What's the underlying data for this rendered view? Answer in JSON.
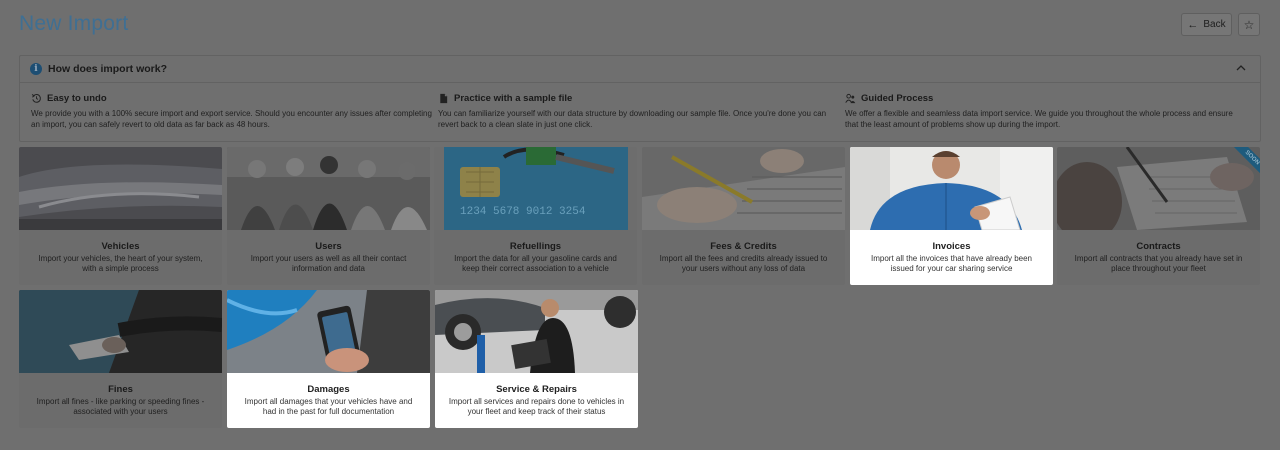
{
  "page": {
    "title": "New Import"
  },
  "header": {
    "back_label": "Back",
    "star_icon": "☆"
  },
  "info": {
    "title": "How does import work?",
    "columns": [
      {
        "icon": "undo-icon",
        "title": "Easy to undo",
        "text": "We provide you with a 100% secure import and export service. Should you encounter any issues after completing an import, you can safely revert to old data as far back as 48 hours."
      },
      {
        "icon": "file-icon",
        "title": "Practice with a sample file",
        "text": "You can familiarize yourself with our data structure by downloading our sample file. Once you're done you can revert back to a clean slate in just one click."
      },
      {
        "icon": "people-icon",
        "title": "Guided Process",
        "text": "We offer a flexible and seamless data import service. We guide you throughout the whole process and ensure that the least amount of problems show up during the import."
      }
    ]
  },
  "cards": [
    {
      "name": "Vehicles",
      "desc": "Import your vehicles, the heart of your system, with a simple process",
      "active": false
    },
    {
      "name": "Users",
      "desc": "Import your users as well as all their contact information and data",
      "active": false
    },
    {
      "name": "Refuellings",
      "desc": "Import the data for all your gasoline cards and keep their correct association to a vehicle",
      "active": false,
      "card_number": "1234   5678   9012  3254"
    },
    {
      "name": "Fees & Credits",
      "desc": "Import all the fees and credits already issued to your users without any loss of data",
      "active": false
    },
    {
      "name": "Invoices",
      "desc": "Import all the invoices that have already been issued for your car sharing service",
      "active": true
    },
    {
      "name": "Contracts",
      "desc": "Import all contracts that you already have set in place throughout your fleet",
      "active": false,
      "badge": "SOON"
    },
    {
      "name": "Fines",
      "desc": "Import all fines - like parking or speeding fines - associated with your users",
      "active": false
    },
    {
      "name": "Damages",
      "desc": "Import all damages that your vehicles have and had in the past for full documentation",
      "active": true
    },
    {
      "name": "Service & Repairs",
      "desc": "Import all services and repairs done to vehicles in your fleet and keep track of their status",
      "active": true
    }
  ]
}
